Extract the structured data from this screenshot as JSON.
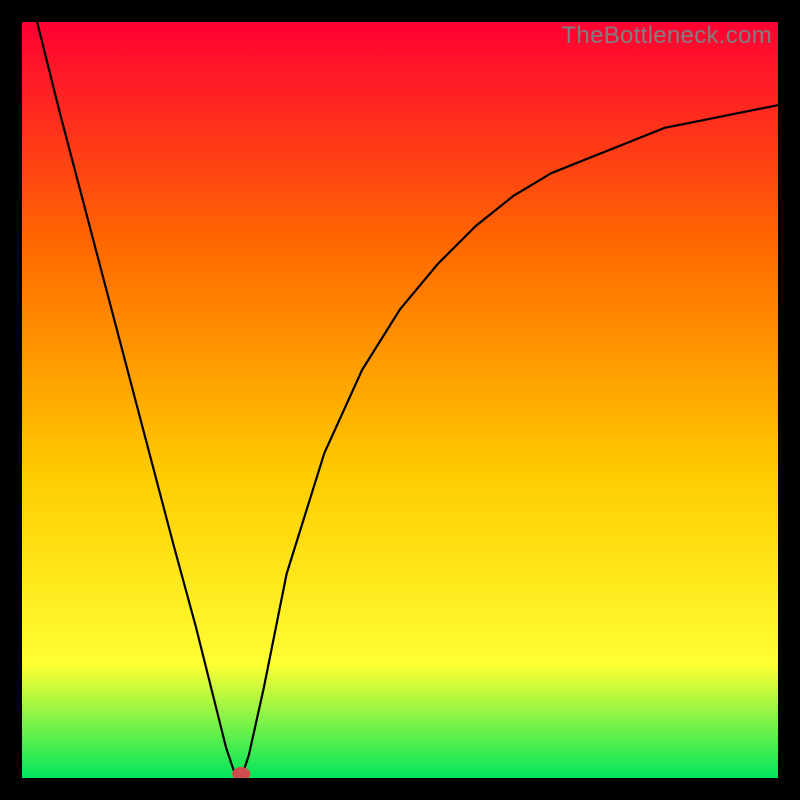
{
  "watermark": "TheBottleneck.com",
  "colors": {
    "background_black": "#000000",
    "gradient_top": "#ff0033",
    "gradient_mid1": "#ff6a00",
    "gradient_mid2": "#ffcc00",
    "gradient_mid3": "#ffff33",
    "gradient_bottom": "#00e65c",
    "curve": "#000000",
    "marker": "#cf4c4c",
    "watermark_text": "#7f7f7f"
  },
  "chart_data": {
    "type": "line",
    "title": "",
    "xlabel": "",
    "ylabel": "",
    "xlim": [
      0,
      100
    ],
    "ylim": [
      0,
      100
    ],
    "grid": false,
    "legend": false,
    "annotations": [
      "TheBottleneck.com"
    ],
    "series": [
      {
        "name": "curve",
        "x": [
          2,
          5,
          10,
          15,
          20,
          23,
          25,
          27,
          28,
          29,
          30,
          32,
          35,
          40,
          45,
          50,
          55,
          60,
          65,
          70,
          75,
          80,
          85,
          90,
          95,
          100
        ],
        "values": [
          100,
          88,
          69,
          50,
          31,
          20,
          12,
          4,
          1,
          0,
          3,
          12,
          27,
          43,
          54,
          62,
          68,
          73,
          77,
          80,
          82,
          84,
          86,
          87,
          88,
          89
        ]
      }
    ],
    "marker": {
      "x": 29,
      "y": 0
    }
  }
}
